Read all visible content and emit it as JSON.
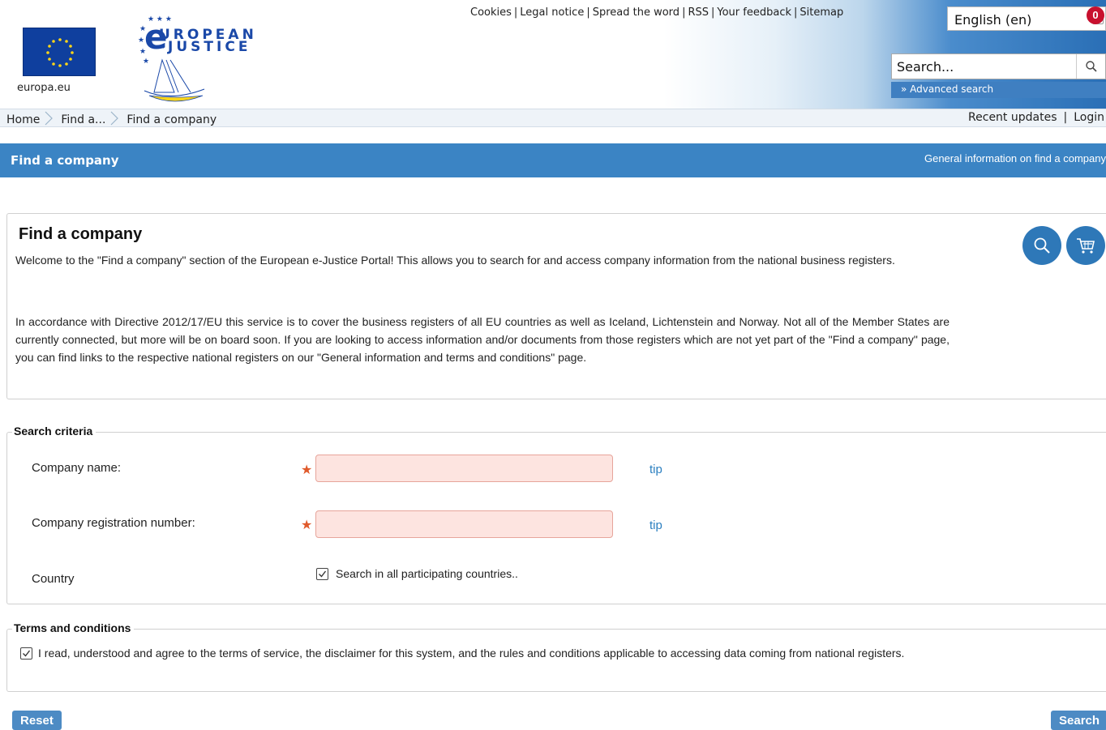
{
  "header": {
    "europa_label": "europa.eu",
    "logo_title_line1": "UROPEAN",
    "logo_title_line2": "-JUSTICE",
    "top_links": [
      "Cookies",
      "Legal notice",
      "Spread the word",
      "RSS",
      "Your feedback",
      "Sitemap"
    ],
    "language": "English (en)",
    "search_placeholder": "Search...",
    "advanced_search": "» Advanced search"
  },
  "breadcrumb": {
    "items": [
      "Home",
      "Find a...",
      "Find a company"
    ],
    "recent_updates": "Recent updates",
    "separator": "|",
    "login": "Login"
  },
  "title_bar": {
    "title": "Find a company",
    "general_info": "General information on find a company"
  },
  "intro": {
    "heading": "Find a company",
    "paragraph1": "Welcome to the \"Find a company\" section of the European e-Justice Portal! This allows you to search for and access company information from the national business registers.",
    "paragraph2": "In accordance with Directive 2012/17/EU this service is to cover the business registers of all EU countries as well as Iceland, Lichtenstein and Norway. Not all of the Member States are currently connected, but more will be on board soon. If you are looking to access information and/or documents from those registers which are not yet part of the \"Find a company\" page, you can find links to the respective national registers on our \"General information and terms and conditions\" page.",
    "cart_count": "0"
  },
  "search_criteria": {
    "legend": "Search criteria",
    "company_name_label": "Company name:",
    "registration_number_label": "Company registration number:",
    "tip": "tip",
    "country_label": "Country",
    "all_countries_label": "Search in all participating countries.."
  },
  "terms": {
    "legend": "Terms and conditions",
    "agree_label": "I read, understood and agree to the terms of service, the disclaimer for this system, and the rules and conditions applicable to accessing data coming from national registers."
  },
  "buttons": {
    "reset": "Reset",
    "search": "Search"
  },
  "colors": {
    "accent_blue": "#3b84c4",
    "required_star": "#e05a2b",
    "field_bg": "#fde4e0",
    "badge_red": "#c8102e"
  }
}
